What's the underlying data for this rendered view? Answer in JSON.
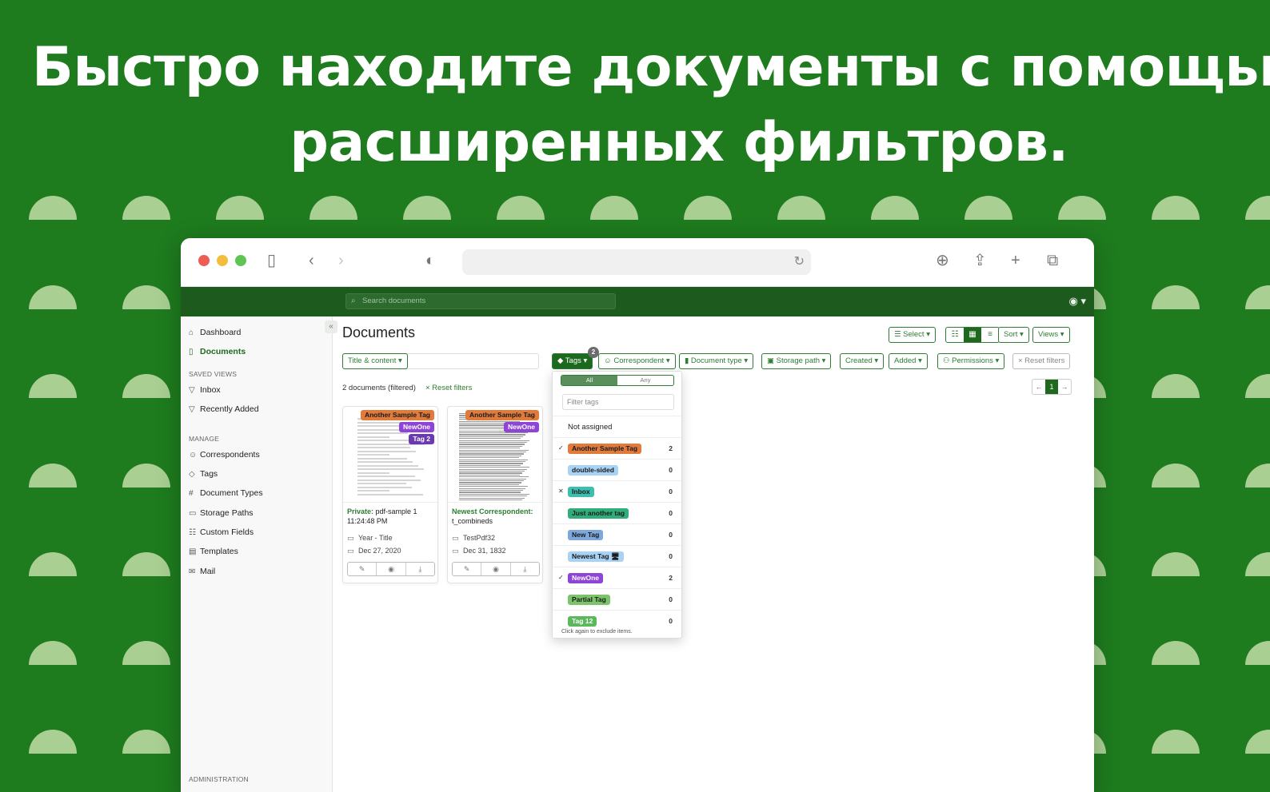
{
  "headline": {
    "line1": "Быстро находите документы с помощью",
    "line2": "расширенных фильтров."
  },
  "browser": {
    "icons": {
      "sidebar": "sidebar-toggle-icon",
      "back": "chevron-left-icon",
      "forward": "chevron-right-icon",
      "shield": "shield-icon",
      "reload": "reload-icon",
      "download": "download-icon",
      "share": "share-icon",
      "new_tab": "plus-icon",
      "tabs": "tabs-overview-icon"
    }
  },
  "app": {
    "search_placeholder": "Search documents",
    "sidebar": {
      "dashboard": "Dashboard",
      "documents": "Documents",
      "saved_views_head": "SAVED VIEWS",
      "inbox": "Inbox",
      "recently_added": "Recently Added",
      "manage_head": "MANAGE",
      "correspondents": "Correspondents",
      "tags": "Tags",
      "document_types": "Document Types",
      "storage_paths": "Storage Paths",
      "custom_fields": "Custom Fields",
      "templates": "Templates",
      "mail": "Mail",
      "administration_head": "ADMINISTRATION"
    },
    "main": {
      "title": "Documents",
      "select": "Select ▾",
      "sort": "Sort ▾",
      "views": "Views ▾",
      "title_content": "Title & content ▾",
      "tags_btn": "Tags ▾",
      "tags_badge": "2",
      "correspondent": "Correspondent ▾",
      "document_type": "Document type ▾",
      "storage_path": "Storage path ▾",
      "created": "Created ▾",
      "added": "Added ▾",
      "permissions": "Permissions ▾",
      "reset_filters_btn": "× Reset filters",
      "doc_count": "2 documents (filtered)",
      "reset_filters_link": "× Reset filters",
      "page": "1"
    },
    "cards": [
      {
        "tags": [
          {
            "label": "Another Sample Tag",
            "bg": "#e07b3c",
            "fg": "#1a1a1a"
          },
          {
            "label": "NewOne",
            "bg": "#8e44d6",
            "fg": "#ffffff"
          },
          {
            "label": "Tag 2",
            "bg": "#6a3ab0",
            "fg": "#ffffff"
          }
        ],
        "title_bold": "Private:",
        "title_rest": " pdf-sample 1 11:24:48 PM",
        "path": "Year - Title",
        "date": "Dec 27, 2020"
      },
      {
        "tags": [
          {
            "label": "Another Sample Tag",
            "bg": "#e07b3c",
            "fg": "#1a1a1a"
          },
          {
            "label": "NewOne",
            "bg": "#8e44d6",
            "fg": "#ffffff"
          }
        ],
        "title_bold": "Newest Correspondent:",
        "title_rest": " t_combineds",
        "path": "TestPdf32",
        "date": "Dec 31, 1832"
      }
    ],
    "dropdown": {
      "all": "All",
      "any": "Any",
      "filter_placeholder": "Filter tags",
      "not_assigned": "Not assigned",
      "items": [
        {
          "label": "Another Sample Tag",
          "bg": "#e07b3c",
          "fg": "#1a1a1a",
          "count": "2",
          "mark": "✓"
        },
        {
          "label": "double-sided",
          "bg": "#a9d3f5",
          "fg": "#1a1a1a",
          "count": "0",
          "mark": ""
        },
        {
          "label": "Inbox",
          "bg": "#3dbfb0",
          "fg": "#1a1a1a",
          "count": "0",
          "mark": "✕"
        },
        {
          "label": "Just another tag",
          "bg": "#2fae7c",
          "fg": "#1a1a1a",
          "count": "0",
          "mark": ""
        },
        {
          "label": "New Tag",
          "bg": "#7ea7dc",
          "fg": "#1a1a1a",
          "count": "0",
          "mark": ""
        },
        {
          "label": "Newest Tag 🖥",
          "bg": "#a9d3f5",
          "fg": "#1a1a1a",
          "count": "0",
          "mark": ""
        },
        {
          "label": "NewOne",
          "bg": "#8e44d6",
          "fg": "#ffffff",
          "count": "2",
          "mark": "✓"
        },
        {
          "label": "Partial Tag",
          "bg": "#7cc46a",
          "fg": "#1a1a1a",
          "count": "0",
          "mark": ""
        },
        {
          "label": "Tag 12",
          "bg": "#5cb85c",
          "fg": "#ffffff",
          "count": "0",
          "mark": ""
        }
      ],
      "hint": "Click again to exclude items."
    }
  },
  "colors": {
    "background": "#1e7b1e",
    "dot": "#a9cf93",
    "app_header": "#1d5a1e",
    "accent": "#2e7d32"
  }
}
